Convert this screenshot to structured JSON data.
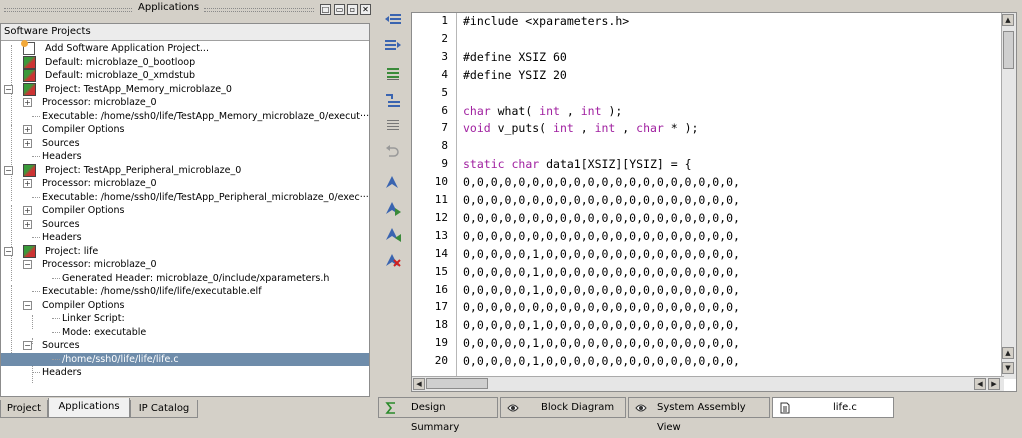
{
  "left_panel": {
    "title": "Applications",
    "tree_header": "Software Projects",
    "rows": [
      {
        "label": "Add Software Application Project..."
      },
      {
        "label": "Default: microblaze_0_bootloop"
      },
      {
        "label": "Default: microblaze_0_xmdstub"
      },
      {
        "label": "Project: TestApp_Memory_microblaze_0"
      },
      {
        "label": "Processor: microblaze_0"
      },
      {
        "label": "Executable: /home/ssh0/life/TestApp_Memory_microblaze_0/execut···"
      },
      {
        "label": "Compiler Options"
      },
      {
        "label": "Sources"
      },
      {
        "label": "Headers"
      },
      {
        "label": "Project: TestApp_Peripheral_microblaze_0"
      },
      {
        "label": "Processor: microblaze_0"
      },
      {
        "label": "Executable: /home/ssh0/life/TestApp_Peripheral_microblaze_0/exec···"
      },
      {
        "label": "Compiler Options"
      },
      {
        "label": "Sources"
      },
      {
        "label": "Headers"
      },
      {
        "label": "Project: life"
      },
      {
        "label": "Processor: microblaze_0"
      },
      {
        "label": "Generated Header: microblaze_0/include/xparameters.h"
      },
      {
        "label": "Executable: /home/ssh0/life/life/executable.elf"
      },
      {
        "label": "Compiler Options"
      },
      {
        "label": "Linker Script:"
      },
      {
        "label": "Mode: executable"
      },
      {
        "label": "Sources"
      },
      {
        "label": "/home/ssh0/life/life/life.c"
      },
      {
        "label": "Headers"
      }
    ],
    "tabs": [
      "Project",
      "Applications",
      "IP Catalog"
    ]
  },
  "editor": {
    "line_numbers": [
      "1",
      "2",
      "3",
      "4",
      "5",
      "6",
      "7",
      "8",
      "9",
      "10",
      "11",
      "12",
      "13",
      "14",
      "15",
      "16",
      "17",
      "18",
      "19",
      "20"
    ],
    "lines": [
      "#include <xparameters.h>",
      "",
      "#define XSIZ 60",
      "#define YSIZ 20",
      "",
      "char what( int , int );",
      "void v_puts( int , int , char * );",
      "",
      "static char data1[XSIZ][YSIZ] = {",
      "0,0,0,0,0,0,0,0,0,0,0,0,0,0,0,0,0,0,0,0,",
      "0,0,0,0,0,0,0,0,0,0,0,0,0,0,0,0,0,0,0,0,",
      "0,0,0,0,0,0,0,0,0,0,0,0,0,0,0,0,0,0,0,0,",
      "0,0,0,0,0,0,0,0,0,0,0,0,0,0,0,0,0,0,0,0,",
      "0,0,0,0,0,1,0,0,0,0,0,0,0,0,0,0,0,0,0,0,",
      "0,0,0,0,0,1,0,0,0,0,0,0,0,0,0,0,0,0,0,0,",
      "0,0,0,0,0,1,0,0,0,0,0,0,0,0,0,0,0,0,0,0,",
      "0,0,0,0,0,0,0,0,0,0,0,0,0,0,0,0,0,0,0,0,",
      "0,0,0,0,0,1,0,0,0,0,0,0,0,0,0,0,0,0,0,0,",
      "0,0,0,0,0,1,0,0,0,0,0,0,0,0,0,0,0,0,0,0,",
      "0,0,0,0,0,1,0,0,0,0,0,0,0,0,0,0,0,0,0,0,"
    ]
  },
  "bottom_tabs": [
    {
      "label": "Design Summary",
      "icon": "sigma-icon"
    },
    {
      "label": "Block Diagram",
      "icon": "eye-icon"
    },
    {
      "label": "System Assembly View",
      "icon": "eye-icon"
    },
    {
      "label": "life.c",
      "icon": "document-icon"
    }
  ],
  "colors": {
    "selection": "#6e8caa",
    "keyword": "#a020a0"
  }
}
